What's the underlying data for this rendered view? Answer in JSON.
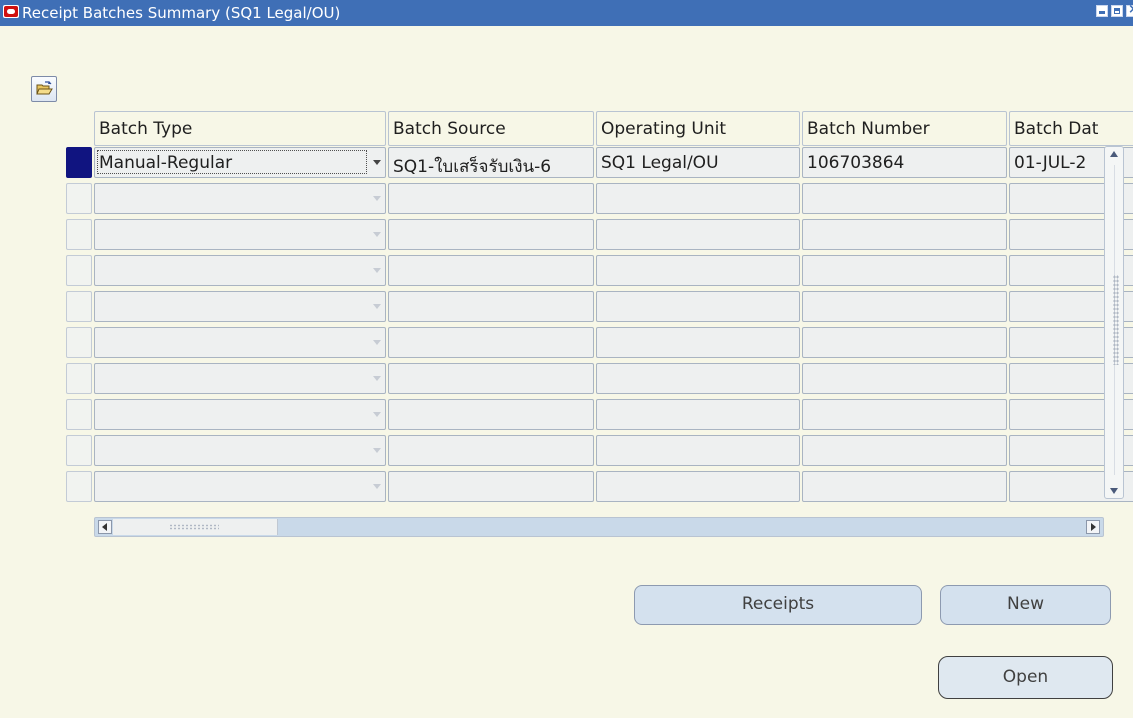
{
  "window": {
    "title": "Receipt Batches Summary (SQ1 Legal/OU)"
  },
  "toolbar": {
    "folder_icon": "open-folder-icon"
  },
  "table": {
    "columns": [
      "Batch Type",
      "Batch Source",
      "Operating Unit",
      "Batch Number",
      "Batch Dat"
    ],
    "rows": [
      [
        "Manual-Regular",
        "SQ1-ใบเสร็จรับเงิน-6",
        "SQ1 Legal/OU",
        "106703864",
        "01-JUL-2"
      ],
      [
        "",
        "",
        "",
        "",
        ""
      ],
      [
        "",
        "",
        "",
        "",
        ""
      ],
      [
        "",
        "",
        "",
        "",
        ""
      ],
      [
        "",
        "",
        "",
        "",
        ""
      ],
      [
        "",
        "",
        "",
        "",
        ""
      ],
      [
        "",
        "",
        "",
        "",
        ""
      ],
      [
        "",
        "",
        "",
        "",
        ""
      ],
      [
        "",
        "",
        "",
        "",
        ""
      ],
      [
        "",
        "",
        "",
        "",
        ""
      ]
    ]
  },
  "buttons": {
    "receipts": "Receipts",
    "new": "New",
    "open": "Open"
  },
  "colors": {
    "titlebar": "#3f6fb6",
    "background": "#f7f7e7",
    "selected_row_marker": "#101480",
    "button_fill": "#d4e1ee"
  }
}
